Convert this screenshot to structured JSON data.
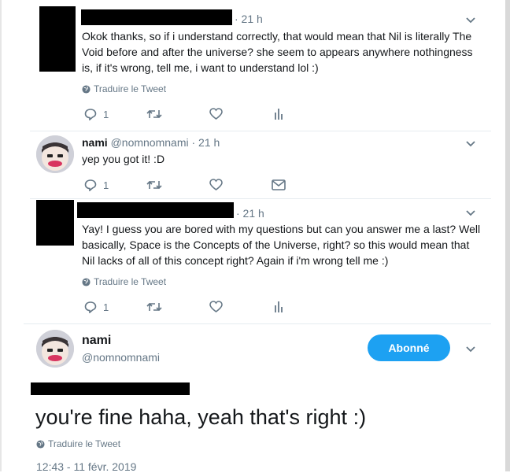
{
  "tweets": [
    {
      "time": "· 21 h",
      "lines": [
        "Okok thanks, so if i understand correctly, that would mean that Nil is literally The",
        "Void before and after the universe? she seem to appears anywhere nothingness",
        "is, if it's wrong, tell me, i want to understand lol :)"
      ],
      "translate": "Traduire le Tweet",
      "reply_count": "1"
    },
    {
      "name": "nami",
      "handle": "@nomnomnami · 21 h",
      "text": "yep you got it! :D",
      "reply_count": "1"
    },
    {
      "time": "· 21 h",
      "lines": [
        "Yay! I guess you are bored with my questions but can you answer me a last? Well",
        "basically, Space is the Concepts of the Universe, right? so this would mean that",
        "Nil lacks of all of this concept right? Again if i'm wrong tell me :)"
      ],
      "translate": "Traduire le Tweet",
      "reply_count": "1"
    }
  ],
  "main": {
    "name": "nami",
    "handle": "@nomnomnami",
    "follow_label": "Abonné",
    "text": "you're fine haha, yeah that's right :)",
    "translate": "Traduire le Tweet",
    "timestamp": "12:43 - 11 févr. 2019"
  },
  "colors": {
    "accent": "#1da1f2",
    "muted": "#657786",
    "text": "#14171a"
  },
  "icons": [
    "reply-icon",
    "retweet-icon",
    "like-icon",
    "analytics-icon",
    "dm-icon",
    "globe-icon",
    "chevron-down-icon"
  ]
}
